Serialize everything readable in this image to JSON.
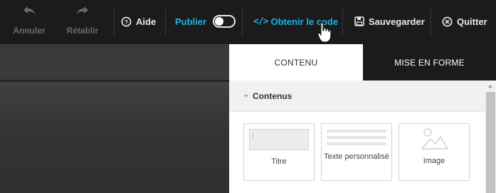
{
  "toolbar": {
    "undo_label": "Annuler",
    "redo_label": "Rétablir",
    "help_label": "Aide",
    "publish_label": "Publier",
    "publish_enabled": false,
    "get_code_label": "Obtenir le code",
    "get_code_glyph": "</>",
    "save_label": "Sauvegarder",
    "quit_label": "Quitter",
    "accent_color": "#23b0e3",
    "disabled_color": "#6b6b6b"
  },
  "panel": {
    "tabs": [
      {
        "label": "CONTENU",
        "active": true
      },
      {
        "label": "MISE EN FORME",
        "active": false
      }
    ],
    "section": {
      "title": "Contenus",
      "items": [
        {
          "label": "Titre",
          "icon": "title-block-icon"
        },
        {
          "label": "Texte personnalisé",
          "icon": "text-lines-icon"
        },
        {
          "label": "Image",
          "icon": "image-icon"
        }
      ]
    }
  }
}
